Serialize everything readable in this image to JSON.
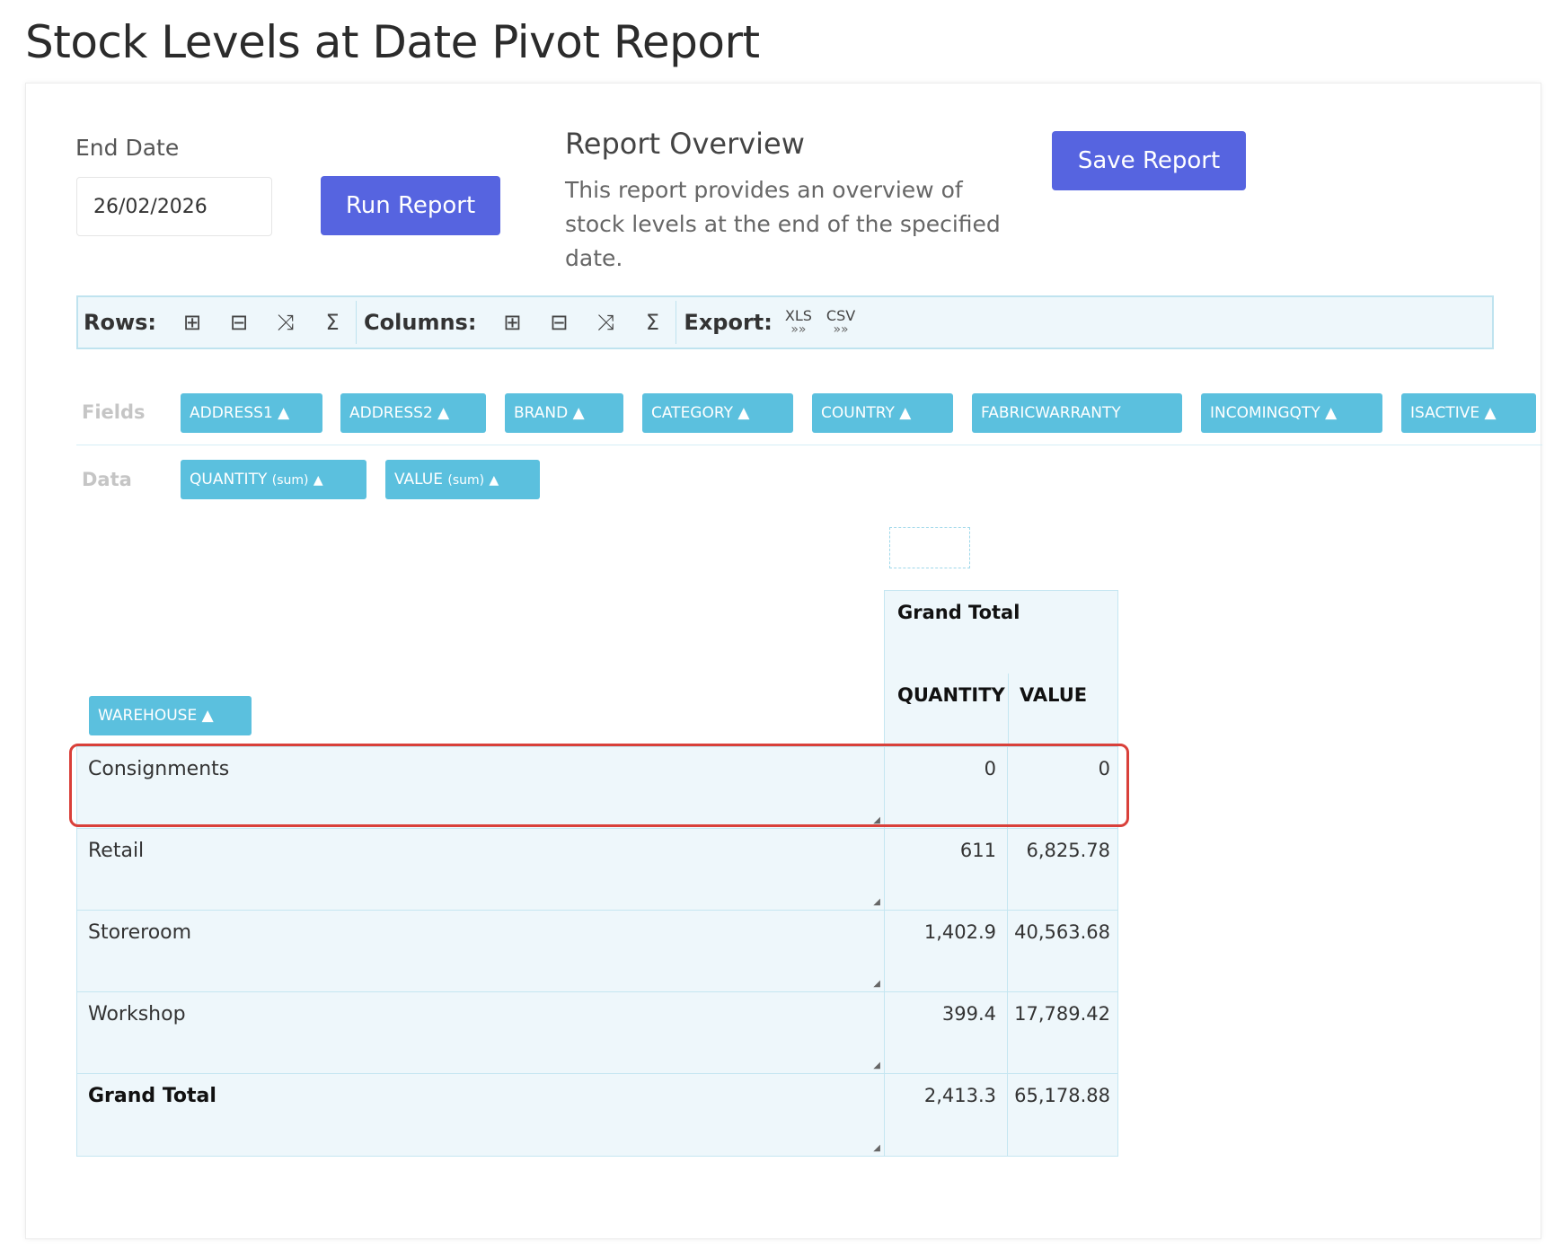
{
  "page": {
    "title": "Stock Levels at Date Pivot Report"
  },
  "form": {
    "end_date_label": "End Date",
    "end_date_value": "26/02/2026",
    "run_label": "Run Report",
    "save_label": "Save Report"
  },
  "overview": {
    "title": "Report Overview",
    "text": "This report provides an overview of stock levels at the end of the specified date."
  },
  "toolbar": {
    "rows_label": "Rows:",
    "columns_label": "Columns:",
    "export_label": "Export:",
    "xls": "XLS",
    "csv": "CSV",
    "icons": [
      "expand-all-icon",
      "collapse-all-icon",
      "toggle-subtotals-icon",
      "sum-icon"
    ]
  },
  "fields": {
    "label": "Fields",
    "chips": [
      "ADDRESS1 ▲",
      "ADDRESS2 ▲",
      "BRAND ▲",
      "CATEGORY ▲",
      "COUNTRY ▲",
      "FABRICWARRANTY",
      "INCOMINGQTY ▲",
      "ISACTIVE ▲"
    ]
  },
  "data_fields": {
    "label": "Data",
    "quantity_chip": "QUANTITY",
    "value_chip": "VALUE",
    "sum_suffix": "(sum)",
    "arrow": "▲"
  },
  "row_field": {
    "chip": "WAREHOUSE ▲"
  },
  "pivot": {
    "column_header": "Grand Total",
    "col_quantity": "QUANTITY",
    "col_value": "VALUE",
    "rows": [
      {
        "name": "Consignments",
        "quantity": "0",
        "value": "0"
      },
      {
        "name": "Retail",
        "quantity": "611",
        "value": "6,825.78"
      },
      {
        "name": "Storeroom",
        "quantity": "1,402.9",
        "value": "40,563.68"
      },
      {
        "name": "Workshop",
        "quantity": "399.4",
        "value": "17,789.42"
      },
      {
        "name": "Grand Total",
        "quantity": "2,413.3",
        "value": "65,178.88"
      }
    ]
  },
  "colors": {
    "primary_button": "#5664e0",
    "chip": "#5bc0de",
    "highlight": "#d9403a"
  }
}
